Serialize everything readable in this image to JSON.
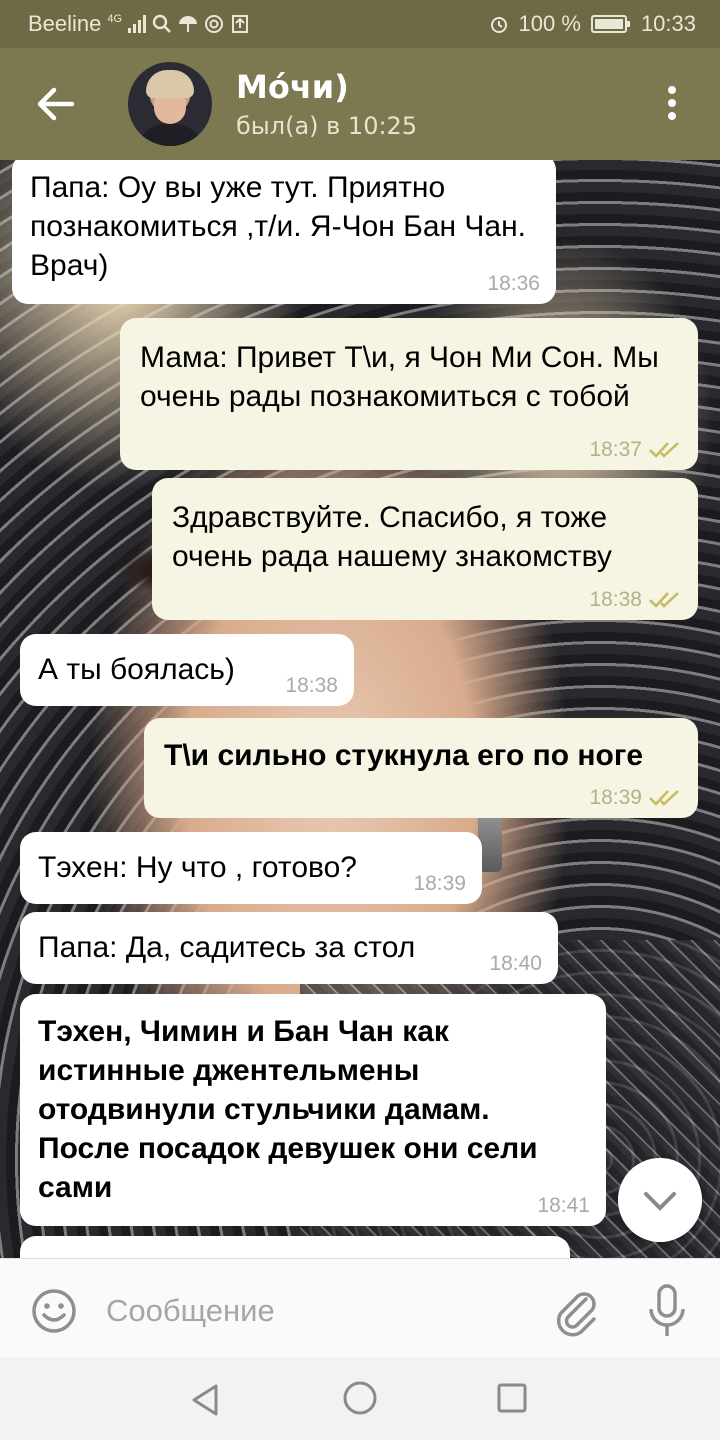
{
  "status_bar": {
    "carrier": "Beeline",
    "network": "4G",
    "battery": "100 %",
    "time": "10:33",
    "icons": [
      "signal-icon",
      "search-icon",
      "umbrella-icon",
      "at-icon",
      "upload-icon",
      "alarm-icon",
      "battery-icon"
    ]
  },
  "header": {
    "title": "Мо́чи)",
    "last_seen": "был(а) в 10:25",
    "icons": [
      "back-arrow-icon",
      "avatar",
      "more-vertical-icon"
    ]
  },
  "messages": [
    {
      "direction": "in",
      "text": "Папа: Оу вы уже тут. Приятно познакомиться ,т/и. Я-Чон Бан Чан. Врач)",
      "time": "18:36",
      "bold": false
    },
    {
      "direction": "out",
      "text": "Мама: Привет Т\\и, я Чон Ми Сон. Мы очень рады познакомиться с тобой",
      "time": "18:37",
      "read": true,
      "bold": false
    },
    {
      "direction": "out",
      "text": "Здравствуйте. Спасибо, я тоже очень рада нашему знакомству",
      "time": "18:38",
      "read": true,
      "bold": false
    },
    {
      "direction": "in",
      "text": "А ты боялась)",
      "time": "18:38",
      "bold": false
    },
    {
      "direction": "out",
      "text": "Т\\и сильно стукнула его по ноге",
      "time": "18:39",
      "read": true,
      "bold": true
    },
    {
      "direction": "in",
      "text": "Тэхен: Ну что , готово?",
      "time": "18:39",
      "bold": false
    },
    {
      "direction": "in",
      "text": "Папа: Да, садитесь за стол",
      "time": "18:40",
      "bold": false
    },
    {
      "direction": "in",
      "text": "Тэхен, Чимин и Бан Чан как истинные джентельмены отодвинули стульчики дамам. После посадок девушек они сели сами",
      "time": "18:41",
      "bold": true
    }
  ],
  "input": {
    "placeholder": "Сообщение",
    "value": ""
  },
  "colors": {
    "header_bg": "#7c784f",
    "status_bg": "#6e6a45",
    "bubble_in": "#ffffff",
    "bubble_out": "#f6f4e2",
    "read_check": "#c9b95a"
  }
}
